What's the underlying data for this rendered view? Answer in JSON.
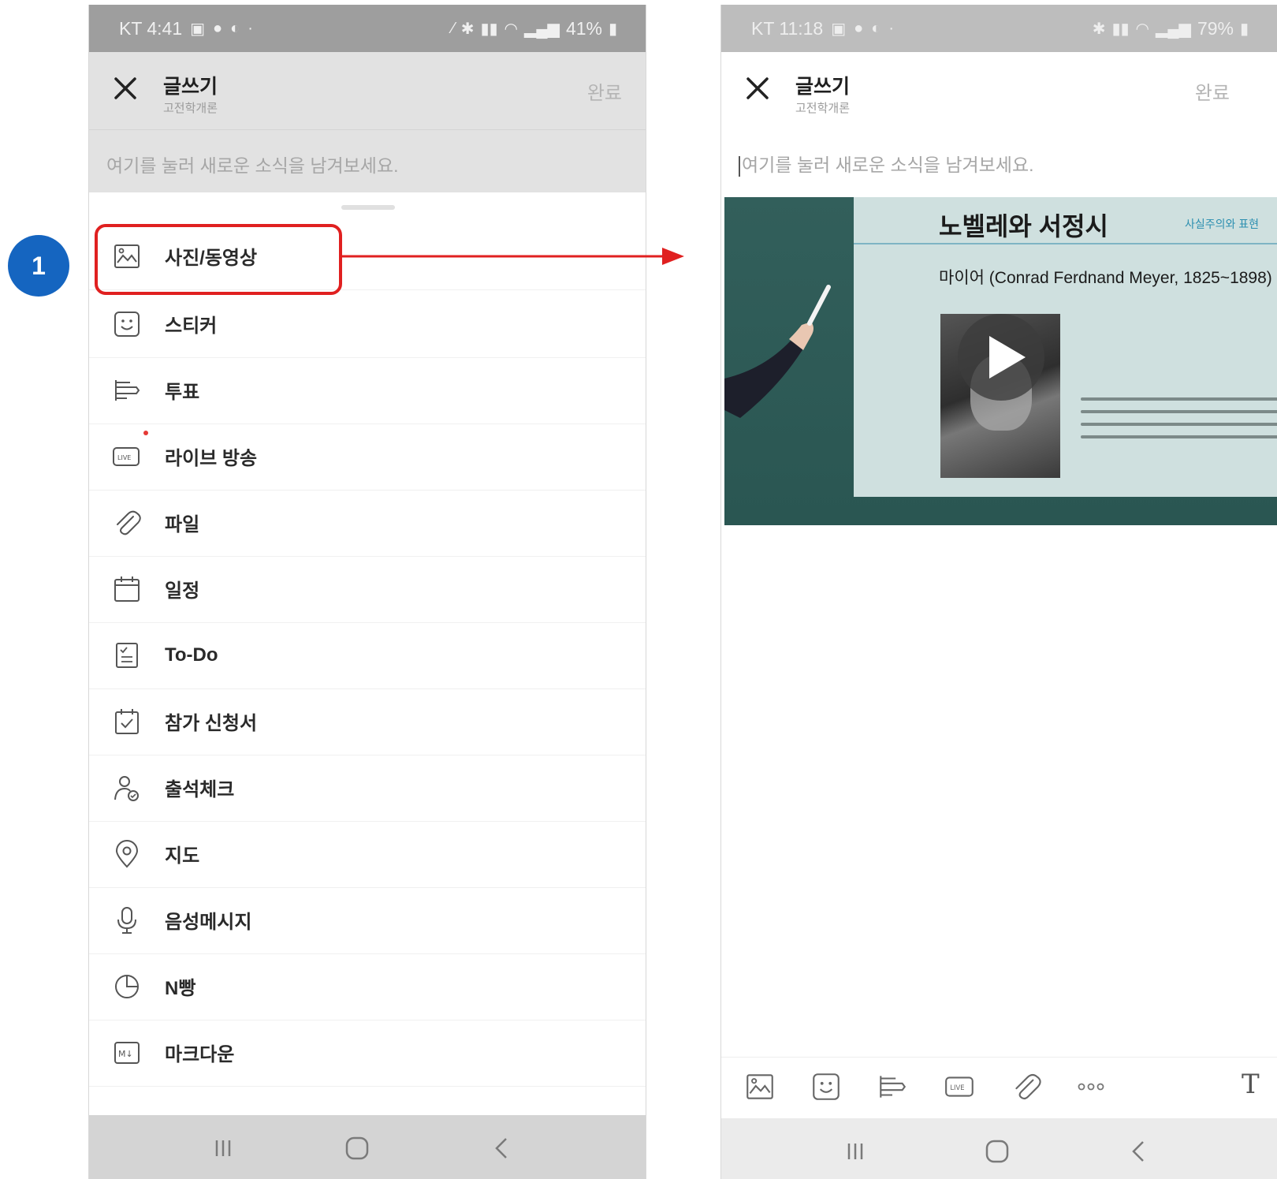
{
  "callout": {
    "step_number": "1"
  },
  "left_screen": {
    "status": {
      "carrier_time": "KT 4:41",
      "battery": "41%"
    },
    "header": {
      "title": "글쓰기",
      "subtitle": "고전학개론",
      "done": "완료"
    },
    "compose_placeholder": "여기를 눌러 새로운 소식을 남겨보세요.",
    "menu": [
      {
        "label": "사진/동영상",
        "icon": "photo-icon"
      },
      {
        "label": "스티커",
        "icon": "sticker-icon"
      },
      {
        "label": "투표",
        "icon": "poll-icon"
      },
      {
        "label": "라이브 방송",
        "icon": "live-icon"
      },
      {
        "label": "파일",
        "icon": "paperclip-icon"
      },
      {
        "label": "일정",
        "icon": "calendar-icon"
      },
      {
        "label": "To-Do",
        "icon": "todo-icon"
      },
      {
        "label": "참가 신청서",
        "icon": "signup-icon"
      },
      {
        "label": "출석체크",
        "icon": "attendance-icon"
      },
      {
        "label": "지도",
        "icon": "map-pin-icon"
      },
      {
        "label": "음성메시지",
        "icon": "microphone-icon"
      },
      {
        "label": "N빵",
        "icon": "split-bill-icon"
      },
      {
        "label": "마크다운",
        "icon": "markdown-icon"
      }
    ]
  },
  "right_screen": {
    "status": {
      "carrier_time": "KT 11:18",
      "battery": "79%"
    },
    "header": {
      "title": "글쓰기",
      "subtitle": "고전학개론",
      "done": "완료"
    },
    "compose_placeholder": "여기를 눌러 새로운 소식을 남겨보세요.",
    "video": {
      "slide_title": "노벨레와 서정시",
      "slide_tag": "사실주의와 표현",
      "slide_subtitle": "마이어 (Conrad Ferdnand Meyer, 1825~1898)"
    },
    "toolbar_text_button": "T"
  },
  "colors": {
    "highlight": "#e02020",
    "badge": "#1565c0",
    "status_bar": "#9e9e9e"
  }
}
